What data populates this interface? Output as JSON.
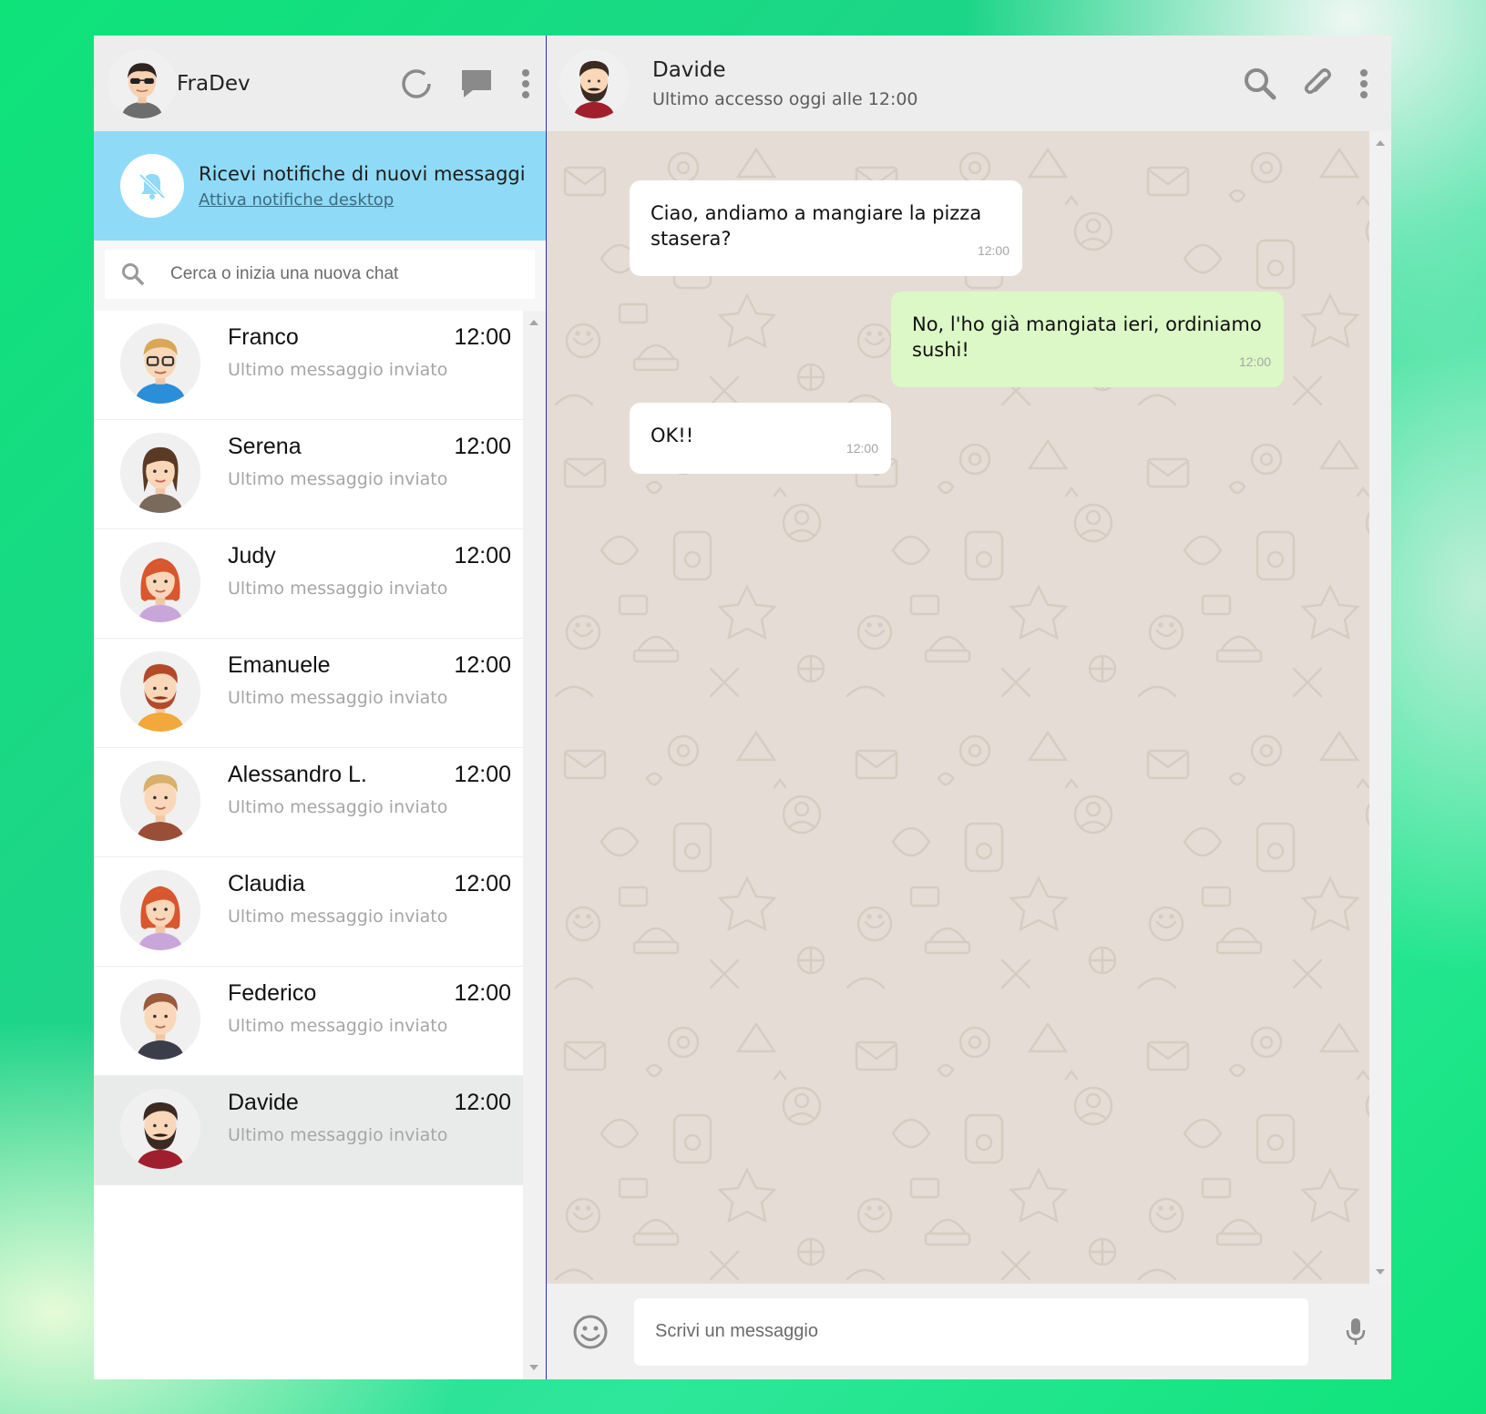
{
  "me": {
    "name": "FraDev"
  },
  "notification": {
    "title": "Ricevi notifiche di nuovi messaggi",
    "link": "Attiva notifiche desktop"
  },
  "search": {
    "placeholder": "Cerca o inizia una nuova chat"
  },
  "chats": [
    {
      "name": "Franco",
      "time": "12:00",
      "last": "Ultimo messaggio inviato",
      "avatar": "man-glasses"
    },
    {
      "name": "Serena",
      "time": "12:00",
      "last": "Ultimo messaggio inviato",
      "avatar": "woman-brown"
    },
    {
      "name": "Judy",
      "time": "12:00",
      "last": "Ultimo messaggio inviato",
      "avatar": "woman-red"
    },
    {
      "name": "Emanuele",
      "time": "12:00",
      "last": "Ultimo messaggio inviato",
      "avatar": "man-mustache"
    },
    {
      "name": "Alessandro L.",
      "time": "12:00",
      "last": "Ultimo messaggio inviato",
      "avatar": "man-blond"
    },
    {
      "name": "Claudia",
      "time": "12:00",
      "last": "Ultimo messaggio inviato",
      "avatar": "woman-red"
    },
    {
      "name": "Federico",
      "time": "12:00",
      "last": "Ultimo messaggio inviato",
      "avatar": "man-brown"
    },
    {
      "name": "Davide",
      "time": "12:00",
      "last": "Ultimo messaggio inviato",
      "avatar": "man-beard",
      "active": true
    }
  ],
  "conversation": {
    "contact_name": "Davide",
    "contact_status": "Ultimo accesso oggi alle 12:00",
    "messages": [
      {
        "direction": "in",
        "text": "Ciao, andiamo a mangiare la pizza stasera?",
        "time": "12:00"
      },
      {
        "direction": "out",
        "text": "No, l'ho già mangiata ieri, ordiniamo sushi!",
        "time": "12:00"
      },
      {
        "direction": "in",
        "text": "OK!!",
        "time": "12:00"
      }
    ]
  },
  "composer": {
    "placeholder": "Scrivi un messaggio"
  },
  "colors": {
    "notification_bg": "#8fdaf7",
    "outgoing_bubble": "#dcf8c6",
    "chat_bg": "#e5ddd5",
    "header_bg": "#ededed"
  }
}
